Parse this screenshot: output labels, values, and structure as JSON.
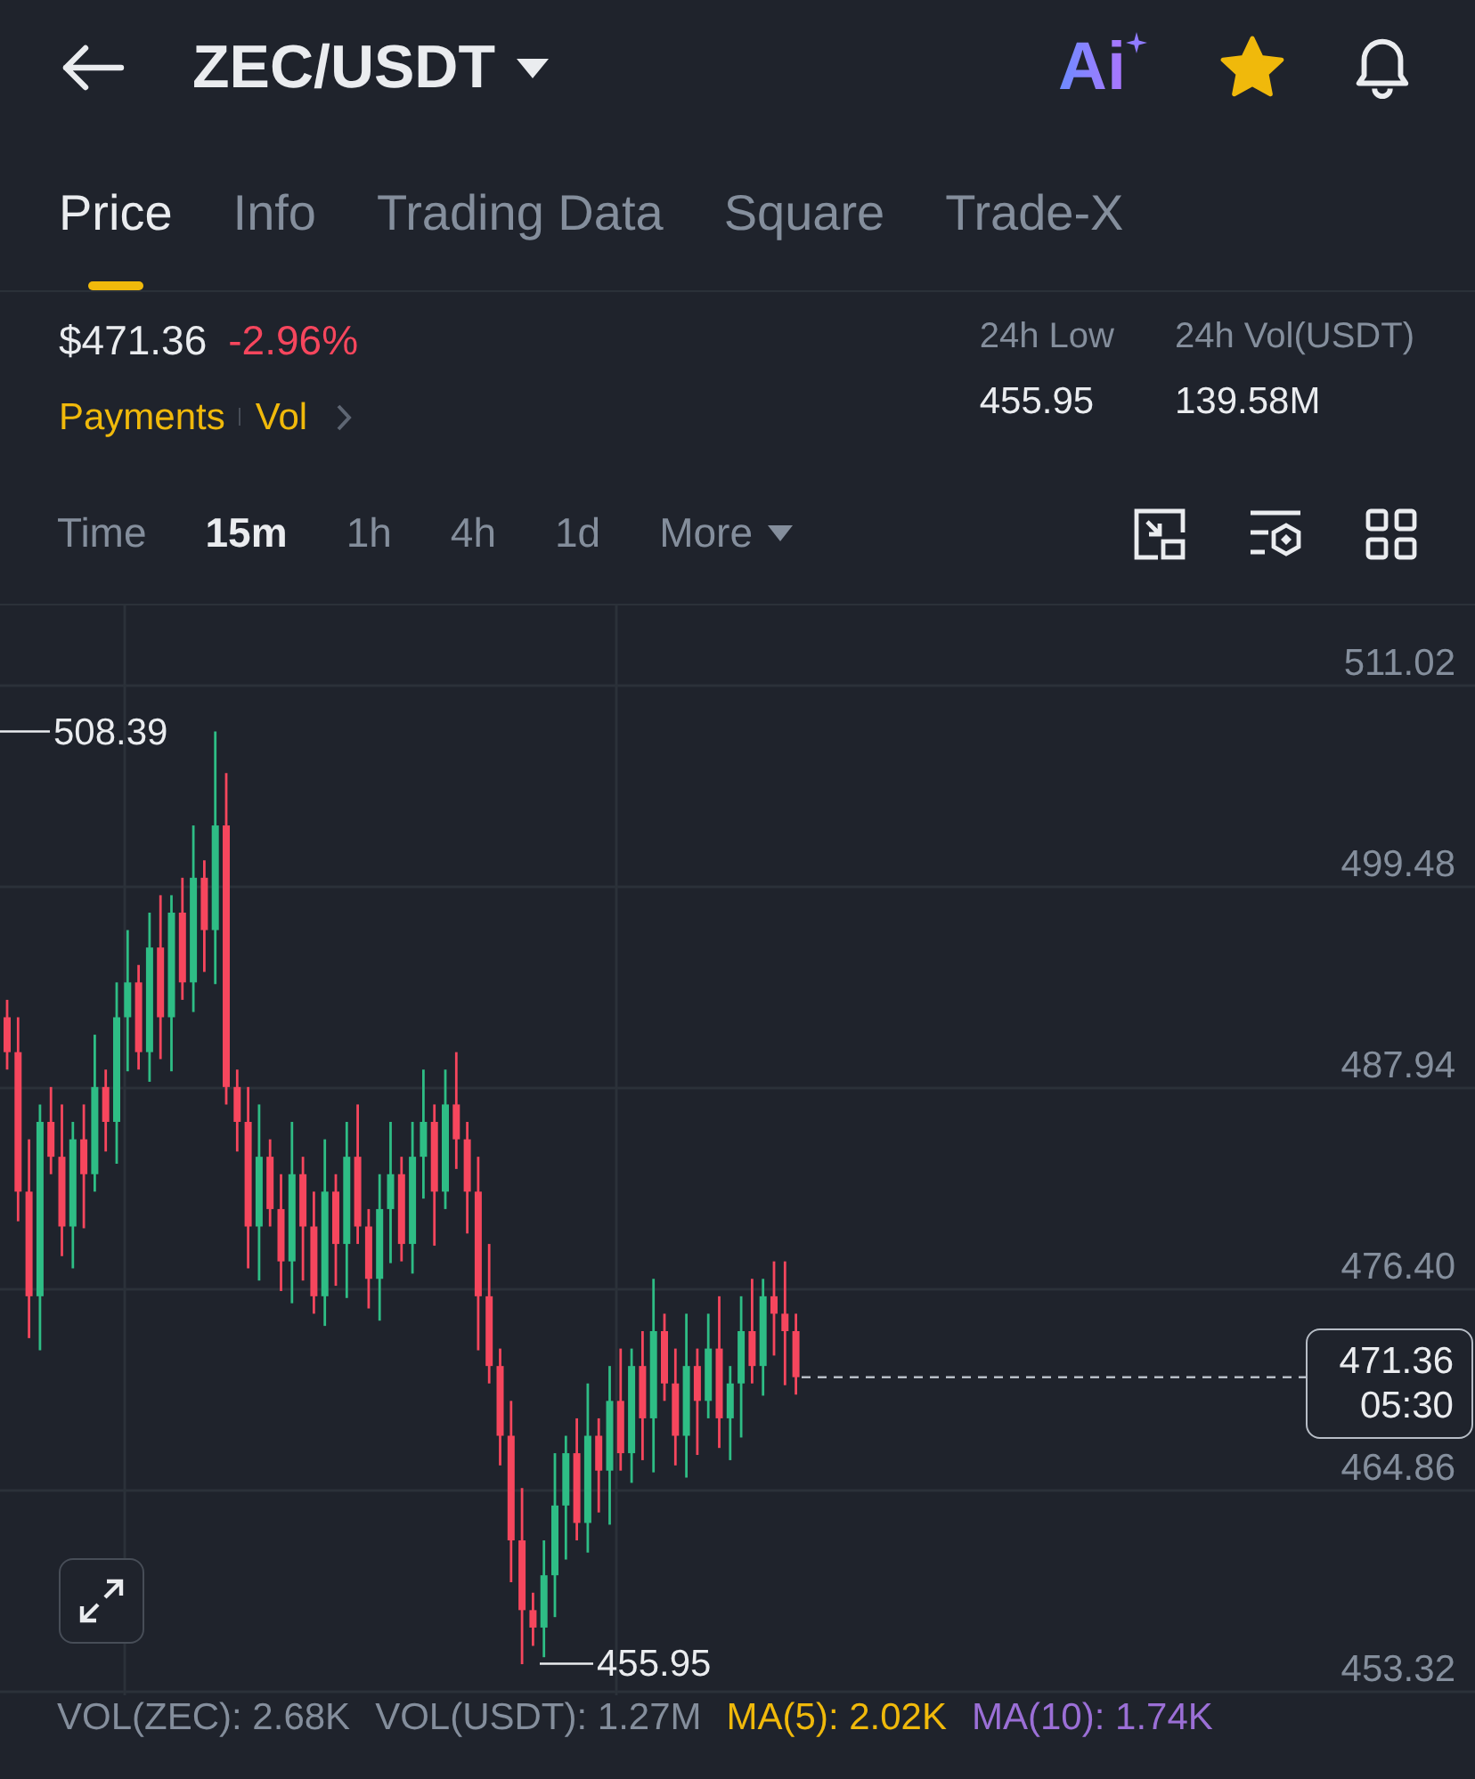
{
  "header": {
    "pair": "ZEC/USDT",
    "ai_label": "Ai",
    "favorited": true
  },
  "tabs": [
    {
      "label": "Price",
      "selected": true
    },
    {
      "label": "Info",
      "selected": false
    },
    {
      "label": "Trading Data",
      "selected": false
    },
    {
      "label": "Square",
      "selected": false
    },
    {
      "label": "Trade-X",
      "selected": false
    }
  ],
  "summary": {
    "price": "$471.36",
    "change": "-2.96%",
    "tags": [
      "Payments",
      "Vol"
    ],
    "stats": [
      {
        "label": "24h Low",
        "value": "455.95"
      },
      {
        "label": "24h Vol(USDT)",
        "value": "139.58M"
      }
    ]
  },
  "intervals": [
    {
      "label": "Time",
      "selected": false
    },
    {
      "label": "15m",
      "selected": true
    },
    {
      "label": "1h",
      "selected": false
    },
    {
      "label": "4h",
      "selected": false
    },
    {
      "label": "1d",
      "selected": false
    },
    {
      "label": "More",
      "selected": false
    }
  ],
  "chart": {
    "price_axis": [
      "511.02",
      "499.48",
      "487.94",
      "476.40",
      "464.86",
      "453.32"
    ],
    "high_marker": "508.39",
    "low_marker": "455.95",
    "current_price": "471.36",
    "countdown": "05:30"
  },
  "volume_legend": [
    {
      "text": "VOL(ZEC): 2.68K",
      "color": "#848e9c"
    },
    {
      "text": "VOL(USDT): 1.27M",
      "color": "#848e9c"
    },
    {
      "text": "MA(5): 2.02K",
      "color": "#f0b90b"
    },
    {
      "text": "MA(10): 1.74K",
      "color": "#9b6fd6"
    }
  ]
}
